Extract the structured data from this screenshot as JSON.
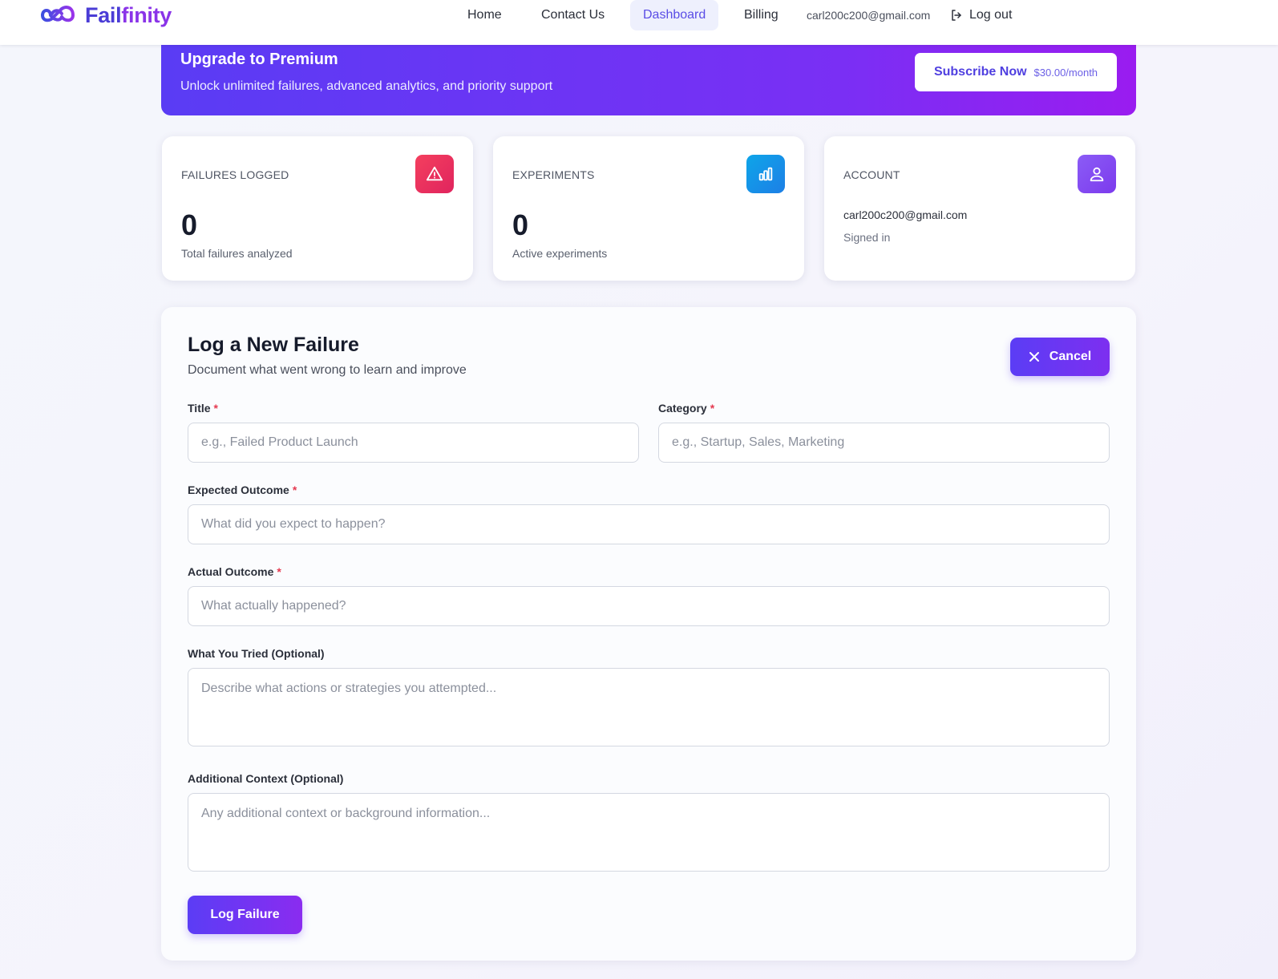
{
  "nav": {
    "logo_part1": "Fail",
    "logo_part2": "finity",
    "links": [
      "Home",
      "Contact Us",
      "Dashboard",
      "Billing"
    ],
    "active_link": "Dashboard",
    "user_email": "carl200c200@gmail.com",
    "logout_label": "Log out"
  },
  "banner": {
    "title": "Upgrade to Premium",
    "subtitle": "Unlock unlimited failures, advanced analytics, and priority support",
    "cta_label": "Subscribe Now",
    "cta_price": "$30.00/month"
  },
  "cards": {
    "failures": {
      "label": "FAILURES LOGGED",
      "value": "0",
      "note": "Total failures analyzed",
      "icon": "alert-triangle-icon",
      "color": "#f43f5e"
    },
    "experiments": {
      "label": "EXPERIMENTS",
      "value": "0",
      "note": "Active experiments",
      "icon": "bar-chart-icon",
      "color": "#0ea5e9"
    },
    "account": {
      "label": "ACCOUNT",
      "email": "carl200c200@gmail.com",
      "status": "Signed in",
      "icon": "user-icon",
      "color": "#8b5cf6"
    }
  },
  "form": {
    "title": "Log a New Failure",
    "subtitle": "Document what went wrong to learn and improve",
    "cancel_label": "Cancel",
    "fields": {
      "title": {
        "label": "Title",
        "required_mark": "*",
        "placeholder": "e.g., Failed Product Launch",
        "value": ""
      },
      "category": {
        "label": "Category",
        "required_mark": "*",
        "placeholder": "e.g., Startup, Sales, Marketing",
        "value": ""
      },
      "expected": {
        "label": "Expected Outcome",
        "required_mark": "*",
        "placeholder": "What did you expect to happen?",
        "value": ""
      },
      "actual": {
        "label": "Actual Outcome",
        "required_mark": "*",
        "placeholder": "What actually happened?",
        "value": ""
      },
      "tried": {
        "label": "What You Tried (Optional)",
        "placeholder": "Describe what actions or strategies you attempted...",
        "value": ""
      },
      "context": {
        "label": "Additional Context (Optional)",
        "placeholder": "Any additional context or background information...",
        "value": ""
      }
    },
    "submit_label": "Log Failure"
  },
  "colors": {
    "accent": "#5b3df5",
    "accent_end": "#9a1cf0",
    "required": "#e53950"
  }
}
